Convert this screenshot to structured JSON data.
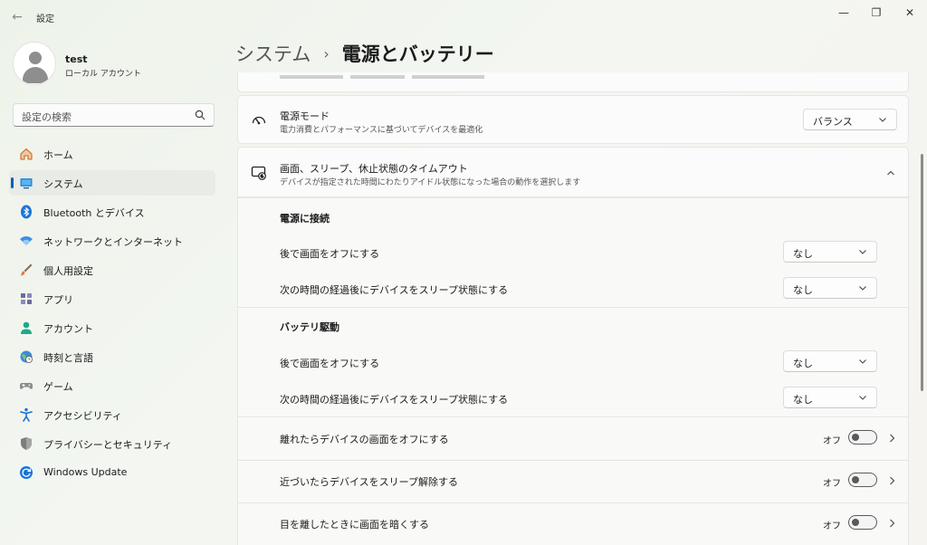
{
  "window": {
    "title": "設定",
    "back_glyph": "←",
    "minimize_glyph": "—",
    "maximize_glyph": "❐",
    "close_glyph": "✕"
  },
  "profile": {
    "name": "test",
    "account_type": "ローカル アカウント"
  },
  "search": {
    "placeholder": "設定の検索"
  },
  "sidebar": {
    "items": [
      {
        "label": "ホーム",
        "icon": "home-icon"
      },
      {
        "label": "システム",
        "icon": "system-icon",
        "selected": true
      },
      {
        "label": "Bluetooth とデバイス",
        "icon": "bluetooth-icon"
      },
      {
        "label": "ネットワークとインターネット",
        "icon": "wifi-icon"
      },
      {
        "label": "個人用設定",
        "icon": "brush-icon"
      },
      {
        "label": "アプリ",
        "icon": "apps-icon"
      },
      {
        "label": "アカウント",
        "icon": "account-icon"
      },
      {
        "label": "時刻と言語",
        "icon": "globe-clock-icon"
      },
      {
        "label": "ゲーム",
        "icon": "gamepad-icon"
      },
      {
        "label": "アクセシビリティ",
        "icon": "accessibility-icon"
      },
      {
        "label": "プライバシーとセキュリティ",
        "icon": "shield-icon"
      },
      {
        "label": "Windows Update",
        "icon": "update-icon"
      }
    ]
  },
  "breadcrumb": {
    "parent": "システム",
    "separator": "›",
    "current": "電源とバッテリー"
  },
  "power_mode": {
    "title": "電源モード",
    "description": "電力消費とパフォーマンスに基づいてデバイスを最適化",
    "value": "バランス"
  },
  "timeout": {
    "title": "画面、スリープ、休止状態のタイムアウト",
    "description": "デバイスが指定された時間にわたりアイドル状態になった場合の動作を選択します",
    "plugged_in": {
      "header": "電源に接続",
      "screen_off_label": "後で画面をオフにする",
      "screen_off_value": "なし",
      "sleep_label": "次の時間の経過後にデバイスをスリープ状態にする",
      "sleep_value": "なし"
    },
    "battery": {
      "header": "バッテリ駆動",
      "screen_off_label": "後で画面をオフにする",
      "screen_off_value": "なし",
      "sleep_label": "次の時間の経過後にデバイスをスリープ状態にする",
      "sleep_value": "なし"
    }
  },
  "presence": [
    {
      "label": "離れたらデバイスの画面をオフにする",
      "state": "オフ"
    },
    {
      "label": "近づいたらデバイスをスリープ解除する",
      "state": "オフ"
    },
    {
      "label": "目を離したときに画面を暗くする",
      "state": "オフ"
    }
  ],
  "colors": {
    "accent": "#005fb8",
    "selected_bg": "#e8ebe6"
  }
}
